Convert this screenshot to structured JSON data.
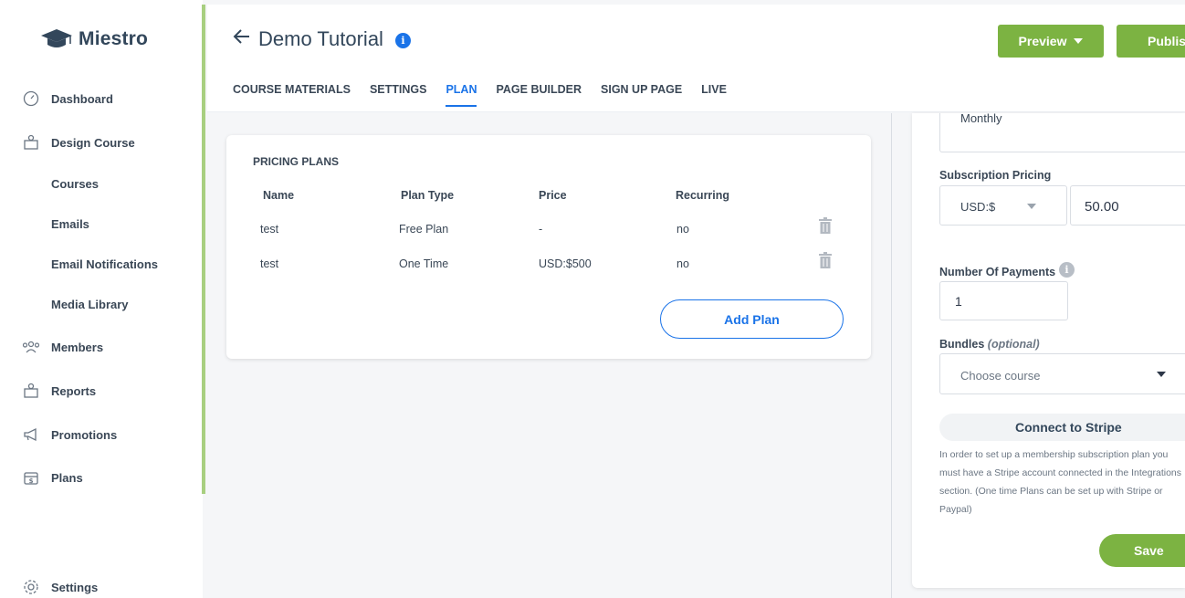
{
  "brand": {
    "name": "Miestro"
  },
  "sidebar": {
    "items": [
      {
        "label": "Dashboard",
        "icon": "dashboard-icon"
      },
      {
        "label": "Design Course",
        "icon": "design-icon"
      },
      {
        "label": "Members",
        "icon": "members-icon"
      },
      {
        "label": "Reports",
        "icon": "reports-icon"
      },
      {
        "label": "Promotions",
        "icon": "megaphone-icon"
      },
      {
        "label": "Plans",
        "icon": "plans-icon"
      },
      {
        "label": "Settings",
        "icon": "gear-icon"
      }
    ],
    "sub_items": [
      "Courses",
      "Emails",
      "Email Notifications",
      "Media Library"
    ]
  },
  "header": {
    "title": "Demo Tutorial",
    "info_glyph": "i",
    "preview_label": "Preview",
    "publish_label": "Publish",
    "tabs": [
      "COURSE MATERIALS",
      "SETTINGS",
      "PLAN",
      "PAGE BUILDER",
      "SIGN UP PAGE",
      "LIVE"
    ],
    "active_tab": "PLAN"
  },
  "pricing_plans": {
    "title": "PRICING PLANS",
    "columns": [
      "Name",
      "Plan Type",
      "Price",
      "Recurring"
    ],
    "rows": [
      {
        "name": "test",
        "plan_type": "Free Plan",
        "price": "-",
        "recurring": "no"
      },
      {
        "name": "test",
        "plan_type": "One Time",
        "price": "USD:$500",
        "recurring": "no"
      }
    ],
    "add_label": "Add Plan"
  },
  "plan_form": {
    "frequency_value": "Monthly",
    "subscription_pricing_label": "Subscription Pricing",
    "currency": "USD:$",
    "amount": "50.00",
    "payments_label": "Number Of Payments",
    "payments_info_glyph": "i",
    "payments_value": "1",
    "bundles_label": "Bundles",
    "bundles_optional": "(optional)",
    "bundles_placeholder": "Choose course",
    "stripe_label": "Connect to Stripe",
    "stripe_note": "In order to set up a membership subscription plan you must have a Stripe account connected in the Integrations section. (One time Plans can be set up with Stripe or Paypal)",
    "save_label": "Save"
  },
  "colors": {
    "accent_green": "#7cb342",
    "accent_blue": "#1a73e8",
    "sidebar_accent": "#a8cf80"
  }
}
